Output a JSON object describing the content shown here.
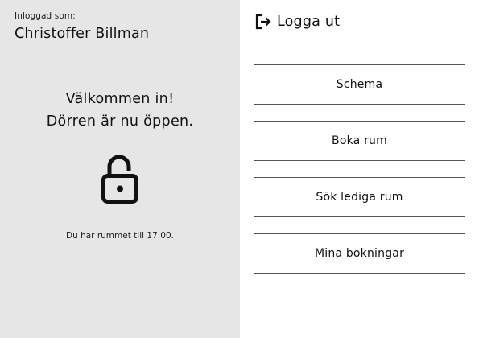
{
  "session": {
    "logged_in_caption": "Inloggad som:",
    "user_name": "Christoffer Billman"
  },
  "status": {
    "welcome_line_1": "Välkommen in!",
    "welcome_line_2": "Dörren är nu öppen.",
    "lock_icon": "unlocked-padlock",
    "room_until_note": "Du har rummet till 17:00."
  },
  "logout": {
    "icon": "logout-arrow",
    "label": "Logga ut"
  },
  "menu": {
    "schedule_label": "Schema",
    "book_room_label": "Boka rum",
    "search_free_label": "Sök lediga rum",
    "my_bookings_label": "Mina bokningar"
  },
  "colors": {
    "left_panel_bg": "#e6e6e6",
    "button_border": "#555555",
    "text": "#111111"
  }
}
